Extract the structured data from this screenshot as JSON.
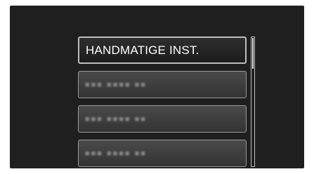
{
  "menu": {
    "items": [
      {
        "label": "HANDMATIGE INST.",
        "selected": true,
        "blurred": false
      },
      {
        "label": "■■■ ■■■■ ■■",
        "selected": false,
        "blurred": true
      },
      {
        "label": "■■■ ■■■■ ■■",
        "selected": false,
        "blurred": true
      },
      {
        "label": "■■■ ■■■■ ■■",
        "selected": false,
        "blurred": true
      }
    ]
  },
  "scrollbar": {
    "position_fraction": 0.0,
    "visible_fraction": 0.25
  },
  "colors": {
    "screen_background": "#1f1f1f",
    "item_border": "#9a9a9a",
    "selected_border": "#bdbdbd",
    "text": "#ffffff"
  }
}
